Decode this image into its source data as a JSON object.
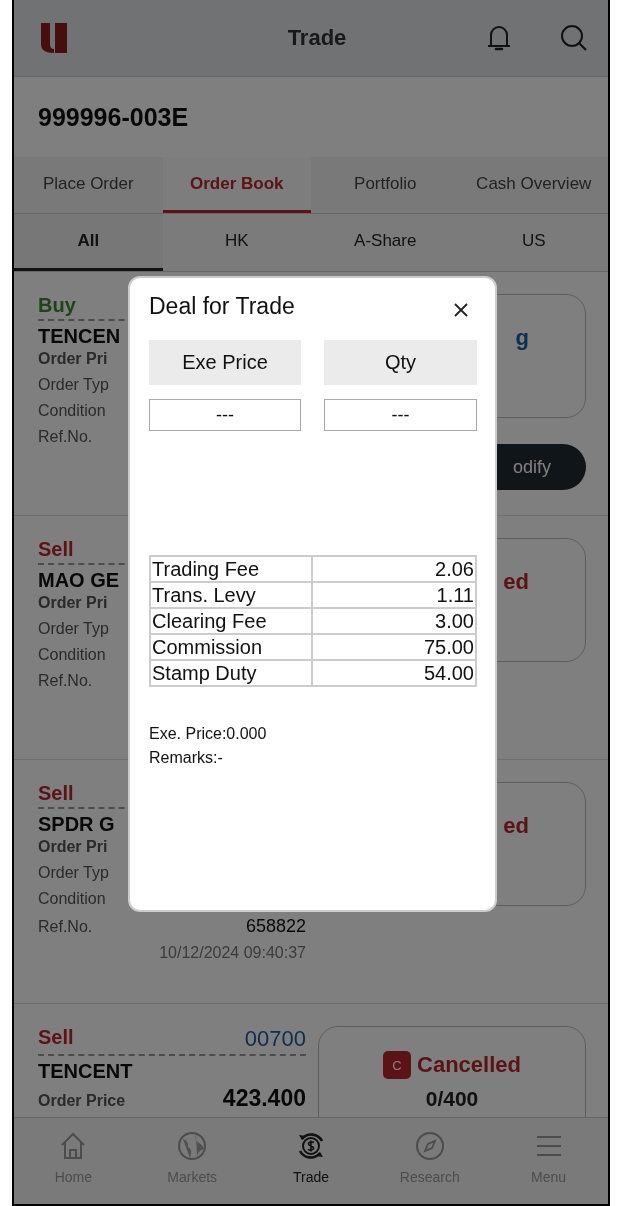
{
  "header": {
    "title": "Trade"
  },
  "account": "999996-003E",
  "tabs": [
    {
      "label": "Place Order",
      "selected": false
    },
    {
      "label": "Order Book",
      "selected": true
    },
    {
      "label": "Portfolio",
      "selected": false
    },
    {
      "label": "Cash Overview",
      "selected": false
    }
  ],
  "market_tabs": [
    {
      "label": "All",
      "selected": true
    },
    {
      "label": "HK",
      "selected": false
    },
    {
      "label": "A-Share",
      "selected": false
    },
    {
      "label": "US",
      "selected": false
    }
  ],
  "orders": [
    {
      "side": "Buy",
      "buy": true,
      "name": "TENCEN",
      "rows": [
        {
          "label": "Order Pri"
        },
        {
          "label": "Order Typ"
        },
        {
          "label": "Condition"
        },
        {
          "label": "Ref.No."
        }
      ],
      "status": "g",
      "cancelled": false,
      "action": "odify"
    },
    {
      "side": "Sell",
      "buy": false,
      "name": "MAO GE",
      "rows": [
        {
          "label": "Order Pri"
        },
        {
          "label": "Order Typ"
        },
        {
          "label": "Condition"
        },
        {
          "label": "Ref.No."
        }
      ],
      "status": "ed",
      "cancelled": true
    },
    {
      "side": "Sell",
      "buy": false,
      "name": "SPDR G",
      "rows": [
        {
          "label": "Order Pri"
        },
        {
          "label": "Order Typ"
        },
        {
          "label": "Condition"
        },
        {
          "label": "Ref.No.",
          "value": "658822"
        }
      ],
      "time": "10/12/2024 09:40:37",
      "status": "ed",
      "cancelled": true
    },
    {
      "side": "Sell",
      "buy": false,
      "code": "00700",
      "name": "TENCENT",
      "rows": [
        {
          "label": "Order Price",
          "value": "423.400"
        }
      ],
      "status": "Cancelled",
      "cancelled": true,
      "status_badge": "C",
      "fill": "0/400"
    }
  ],
  "modal": {
    "title": "Deal for Trade",
    "columns": [
      "Exe Price",
      "Qty"
    ],
    "values": [
      "---",
      "---"
    ],
    "fees": [
      {
        "label": "Trading Fee",
        "value": "2.06"
      },
      {
        "label": "Trans. Levy",
        "value": "1.11"
      },
      {
        "label": "Clearing Fee",
        "value": "3.00"
      },
      {
        "label": "Commission",
        "value": "75.00"
      },
      {
        "label": "Stamp Duty",
        "value": "54.00"
      }
    ],
    "exe_price": "Exe. Price:0.000",
    "remarks": "Remarks:-"
  },
  "bottom_nav": [
    {
      "label": "Home",
      "selected": false
    },
    {
      "label": "Markets",
      "selected": false
    },
    {
      "label": "Trade",
      "selected": true
    },
    {
      "label": "Research",
      "selected": false
    },
    {
      "label": "Menu",
      "selected": false
    }
  ]
}
